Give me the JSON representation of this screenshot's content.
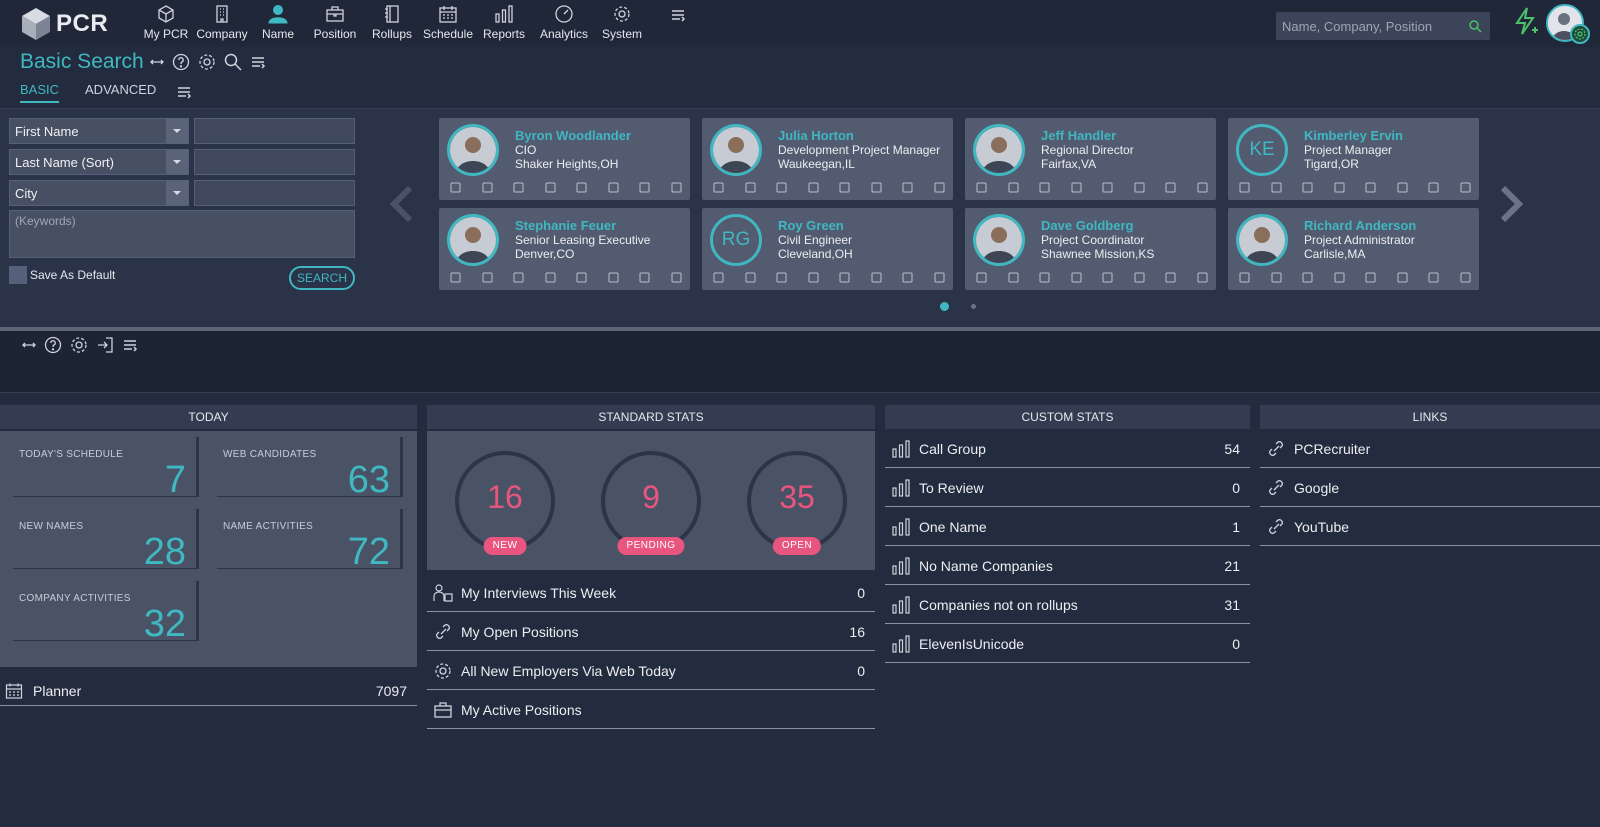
{
  "app": {
    "logo_text": "PCR"
  },
  "nav": {
    "items": [
      {
        "label": "My PCR",
        "icon": "cube-icon"
      },
      {
        "label": "Company",
        "icon": "building-icon"
      },
      {
        "label": "Name",
        "icon": "person-icon",
        "active": true
      },
      {
        "label": "Position",
        "icon": "briefcase-icon"
      },
      {
        "label": "Rollups",
        "icon": "notebook-icon"
      },
      {
        "label": "Schedule",
        "icon": "calendar-icon"
      },
      {
        "label": "Reports",
        "icon": "bar-chart-icon"
      },
      {
        "label": "Analytics",
        "icon": "gauge-icon"
      },
      {
        "label": "System",
        "icon": "gear-icon"
      }
    ],
    "search_placeholder": "Name, Company, Position"
  },
  "search_panel": {
    "title": "Basic Search",
    "tabs": [
      "BASIC",
      "ADVANCED"
    ],
    "fields": [
      "First Name",
      "Last Name (Sort)",
      "City"
    ],
    "keywords_placeholder": "(Keywords)",
    "save_default_label": "Save As Default",
    "search_button": "SEARCH"
  },
  "carousel": {
    "cards": [
      {
        "name": "Byron Woodlander",
        "title": "CIO",
        "location": "Shaker Heights,OH",
        "initials": ""
      },
      {
        "name": "Julia Horton",
        "title": "Development Project Manager",
        "location": "Waukeegan,IL",
        "initials": ""
      },
      {
        "name": "Jeff Handler",
        "title": "Regional Director",
        "location": "Fairfax,VA",
        "initials": ""
      },
      {
        "name": "Kimberley Ervin",
        "title": "Project Manager",
        "location": "Tigard,OR",
        "initials": "KE"
      },
      {
        "name": "Stephanie Feuer",
        "title": "Senior Leasing Executive",
        "location": "Denver,CO",
        "initials": ""
      },
      {
        "name": "Roy Green",
        "title": "Civil Engineer",
        "location": "Cleveland,OH",
        "initials": "RG"
      },
      {
        "name": "Dave Goldberg",
        "title": "Project Coordinator",
        "location": "Shawnee Mission,KS",
        "initials": ""
      },
      {
        "name": "Richard Anderson",
        "title": "Project Administrator",
        "location": "Carlisle,MA",
        "initials": ""
      }
    ],
    "page_count": 2,
    "active_page": 1
  },
  "widgets": {
    "today": {
      "title": "TODAY",
      "stats": [
        {
          "label": "TODAY'S SCHEDULE",
          "value": "7"
        },
        {
          "label": "WEB CANDIDATES",
          "value": "63"
        },
        {
          "label": "NEW NAMES",
          "value": "28"
        },
        {
          "label": "NAME ACTIVITIES",
          "value": "72"
        },
        {
          "label": "COMPANY ACTIVITIES",
          "value": "32"
        }
      ],
      "planner_label": "Planner",
      "planner_value": "7097"
    },
    "standard": {
      "title": "STANDARD STATS",
      "gauges": [
        {
          "value": "16",
          "label": "NEW"
        },
        {
          "value": "9",
          "label": "PENDING"
        },
        {
          "value": "35",
          "label": "OPEN"
        }
      ],
      "rows": [
        {
          "label": "My Interviews This Week",
          "value": "0",
          "icon": "interview-icon"
        },
        {
          "label": "My Open Positions",
          "value": "16",
          "icon": "link-icon"
        },
        {
          "label": "All New Employers Via Web Today",
          "value": "0",
          "icon": "gear-icon"
        },
        {
          "label": "My Active Positions",
          "value": "",
          "icon": "briefcase-icon"
        }
      ]
    },
    "custom": {
      "title": "CUSTOM STATS",
      "rows": [
        {
          "label": "Call Group",
          "value": "54"
        },
        {
          "label": "To Review",
          "value": "0"
        },
        {
          "label": "One Name",
          "value": "1"
        },
        {
          "label": "No Name Companies",
          "value": "21"
        },
        {
          "label": "Companies not on rollups",
          "value": "31"
        },
        {
          "label": "ElevenIsUnicode",
          "value": "0"
        }
      ]
    },
    "links": {
      "title": "LINKS",
      "rows": [
        {
          "label": "PCRecruiter"
        },
        {
          "label": "Google"
        },
        {
          "label": "YouTube"
        }
      ]
    }
  },
  "colors": {
    "accent": "#3fb8c2",
    "badge": "#e8557e",
    "background": "#232b3e"
  }
}
